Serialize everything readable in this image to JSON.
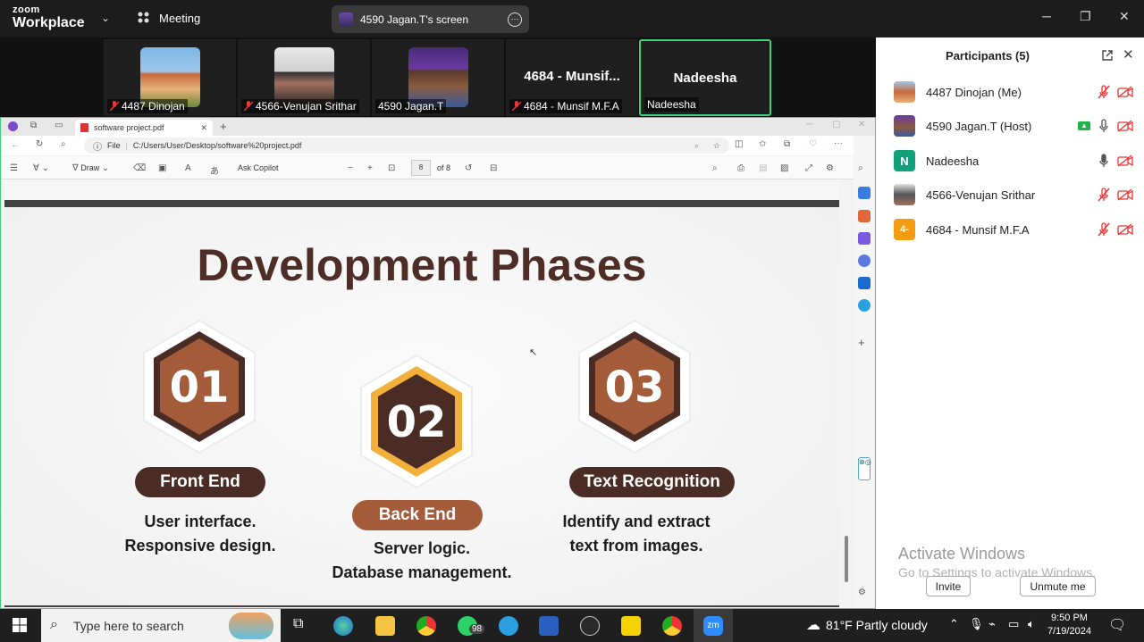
{
  "app": {
    "logo_top": "zoom",
    "logo_bottom": "Workplace",
    "meeting_label": "Meeting",
    "screen_share_label": "4590 Jagan.T's screen"
  },
  "video_strip": [
    {
      "name": "4487 Dinojan",
      "muted": true
    },
    {
      "name": "4566-Venujan Srithar",
      "muted": true
    },
    {
      "name": "4590 Jagan.T",
      "muted": false
    },
    {
      "name": "4684 - Munsif M.F.A",
      "muted": true,
      "big_label": "4684 - Munsif..."
    },
    {
      "name": "Nadeesha",
      "muted": false,
      "big_label": "Nadeesha",
      "active": true
    }
  ],
  "participants": {
    "title": "Participants (5)",
    "list": [
      {
        "name": "4487 Dinojan (Me)",
        "avatar": "temple",
        "muted": true,
        "share": false
      },
      {
        "name": "4590 Jagan.T (Host)",
        "avatar": "person",
        "muted": false,
        "share": true
      },
      {
        "name": "Nadeesha",
        "avatar": "N",
        "avatar_color": "#12a07a",
        "muted": false,
        "share": false
      },
      {
        "name": "4566-Venujan Srithar",
        "avatar": "person2",
        "muted": true,
        "share": false
      },
      {
        "name": "4684 - Munsif M.F.A",
        "avatar": "4-",
        "avatar_color": "#f39c12",
        "muted": true,
        "share": false
      }
    ],
    "invite_label": "Invite",
    "unmute_label": "Unmute me"
  },
  "watermark": {
    "line1": "Activate Windows",
    "line2": "Go to Settings to activate Windows."
  },
  "browser": {
    "tab_title": "software project.pdf",
    "url_prefix": "File",
    "url": "C:/Users/User/Desktop/software%20project.pdf",
    "toolbar": {
      "draw_label": "Draw",
      "copilot_label": "Ask Copilot",
      "page_number": "8",
      "page_total": "of 8"
    }
  },
  "slide": {
    "title": "Development Phases",
    "phases": [
      {
        "number": "01",
        "label": "Front End",
        "desc_1": "User interface.",
        "desc_2": "Responsive design."
      },
      {
        "number": "02",
        "label": "Back End",
        "desc_1": "Server logic.",
        "desc_2": "Database management."
      },
      {
        "number": "03",
        "label": "Text Recognition",
        "desc_1": "Identify and extract",
        "desc_2": "text from images."
      }
    ],
    "colors": {
      "brown": "#a35b39",
      "dark": "#4a2c24",
      "gold": "#f2b03a"
    }
  },
  "taskbar": {
    "search_placeholder": "Type here to search",
    "whatsapp_badge": "98",
    "weather": "81°F  Partly cloudy",
    "time": "9:50 PM",
    "date": "7/19/2024"
  }
}
